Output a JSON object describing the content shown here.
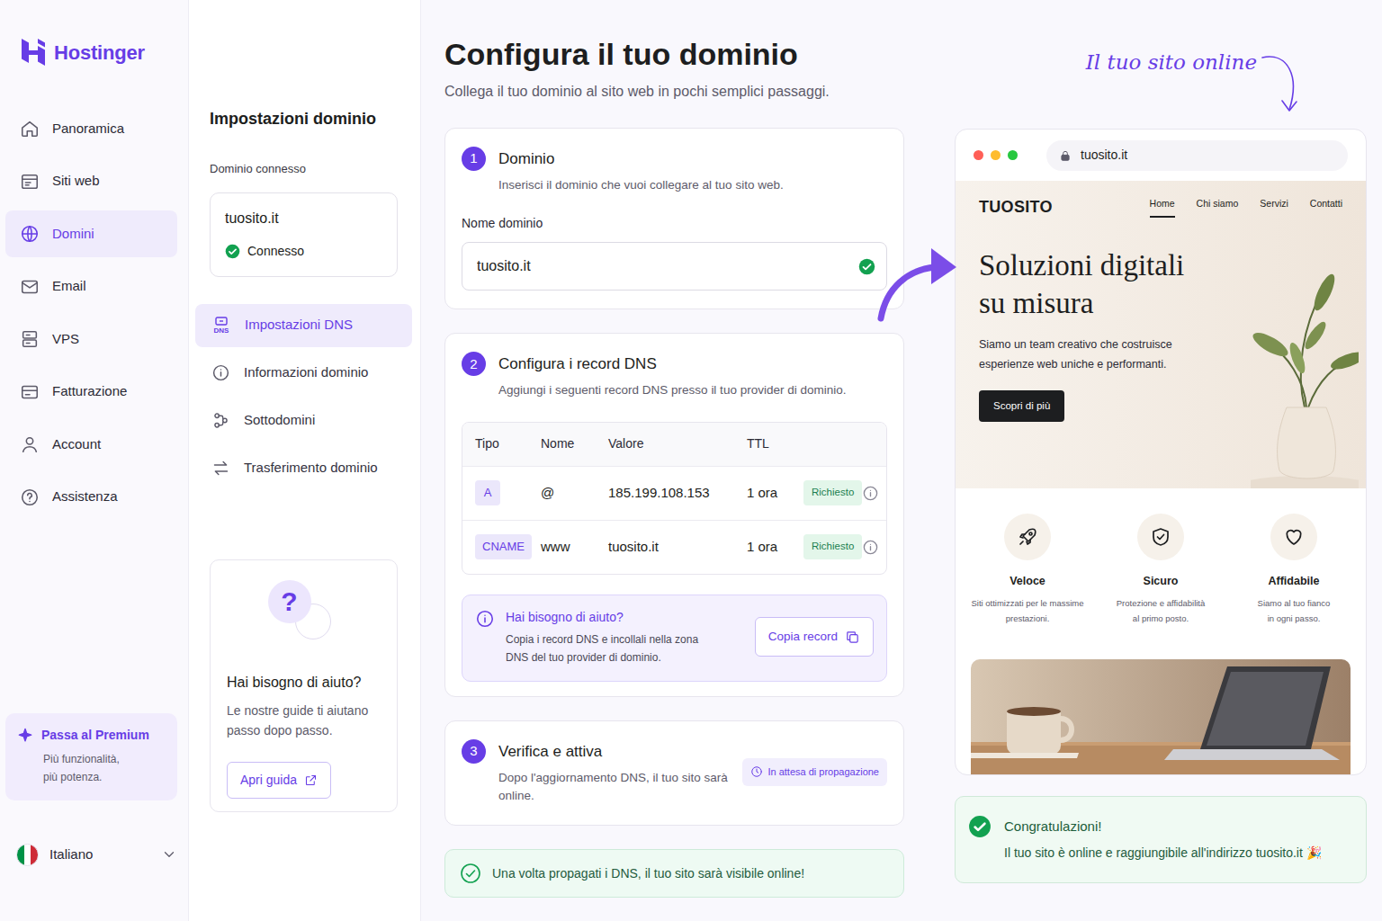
{
  "sidebar": {
    "logo": "Hostinger",
    "items": [
      {
        "label": "Panoramica",
        "selected": false
      },
      {
        "label": "Siti web",
        "selected": false
      },
      {
        "label": "Domini",
        "selected": true
      },
      {
        "label": "Email",
        "selected": false
      },
      {
        "label": "VPS",
        "selected": false
      },
      {
        "label": "Fatturazione",
        "selected": false
      },
      {
        "label": "Account",
        "selected": false
      },
      {
        "label": "Assistenza",
        "selected": false
      }
    ],
    "premium": {
      "title": "Passa al Premium",
      "lines": [
        "Più funzionalità,",
        "più potenza."
      ]
    },
    "language": "Italiano"
  },
  "domain_panel": {
    "title": "Impostazioni dominio",
    "connected_label": "Dominio connesso",
    "domain": "tuosito.it",
    "status": "Connesso",
    "connected": true,
    "dns_icon_text": "DNS",
    "menu": [
      {
        "label": "Impostazioni DNS",
        "selected": true
      },
      {
        "label": "Informazioni dominio",
        "selected": false
      },
      {
        "label": "Sottodomini",
        "selected": false
      },
      {
        "label": "Trasferimento dominio",
        "selected": false
      }
    ],
    "help": {
      "glyph": "?",
      "title": "Hai bisogno di aiuto?",
      "lines": [
        "Le nostre guide ti aiutano",
        "passo dopo passo."
      ],
      "button": "Apri guida"
    }
  },
  "main": {
    "title": "Configura il tuo dominio",
    "subtitle": "Collega il tuo dominio al sito web in pochi semplici passaggi.",
    "step1": {
      "number": "1",
      "title": "Dominio",
      "description": "Inserisci il dominio che vuoi collegare al tuo sito web.",
      "field_label": "Nome dominio",
      "field_value": "tuosito.it",
      "valid": true
    },
    "step2": {
      "number": "2",
      "title": "Configura i record DNS",
      "description": "Aggiungi i seguenti record DNS presso il tuo provider di dominio.",
      "columns": [
        "Tipo",
        "Nome",
        "Valore",
        "TTL"
      ],
      "rows": [
        {
          "type": "A",
          "name": "@",
          "value": "185.199.108.153",
          "ttl": "1 ora",
          "badge": "Richiesto"
        },
        {
          "type": "CNAME",
          "name": "www",
          "value": "tuosito.it",
          "ttl": "1 ora",
          "badge": "Richiesto"
        }
      ],
      "help": {
        "title": "Hai bisogno di aiuto?",
        "lines": [
          "Copia i record DNS e incollali nella zona",
          "DNS del tuo provider di dominio."
        ],
        "button": "Copia record"
      }
    },
    "step3": {
      "number": "3",
      "title": "Verifica e attiva",
      "description": "Dopo l'aggiornamento DNS, il tuo sito sarà online.",
      "badge": "In attesa di propagazione"
    },
    "notice": "Una volta propagati i DNS, il tuo sito sarà visibile online!"
  },
  "preview": {
    "annotation": "Il tuo sito online",
    "url": "tuosito.it",
    "brand": "TUOSITO",
    "nav": [
      {
        "label": "Home",
        "selected": true
      },
      {
        "label": "Chi siamo",
        "selected": false
      },
      {
        "label": "Servizi",
        "selected": false
      },
      {
        "label": "Contatti",
        "selected": false
      }
    ],
    "hero": {
      "title_lines": [
        "Soluzioni digitali",
        "su misura"
      ],
      "text_lines": [
        "Siamo un team creativo che costruisce",
        "esperienze web uniche e performanti."
      ],
      "button": "Scopri di più"
    },
    "features": [
      {
        "title": "Veloce",
        "lines": [
          "Siti ottimizzati per le massime",
          "prestazioni."
        ]
      },
      {
        "title": "Sicuro",
        "lines": [
          "Protezione e affidabilità",
          "al primo posto."
        ]
      },
      {
        "title": "Affidabile",
        "lines": [
          "Siamo al tuo fianco",
          "in ogni passo."
        ]
      }
    ],
    "congrats": {
      "title": "Congratulazioni!",
      "text": "Il tuo sito è online e raggiungibile all'indirizzo tuosito.it 🎉"
    }
  }
}
